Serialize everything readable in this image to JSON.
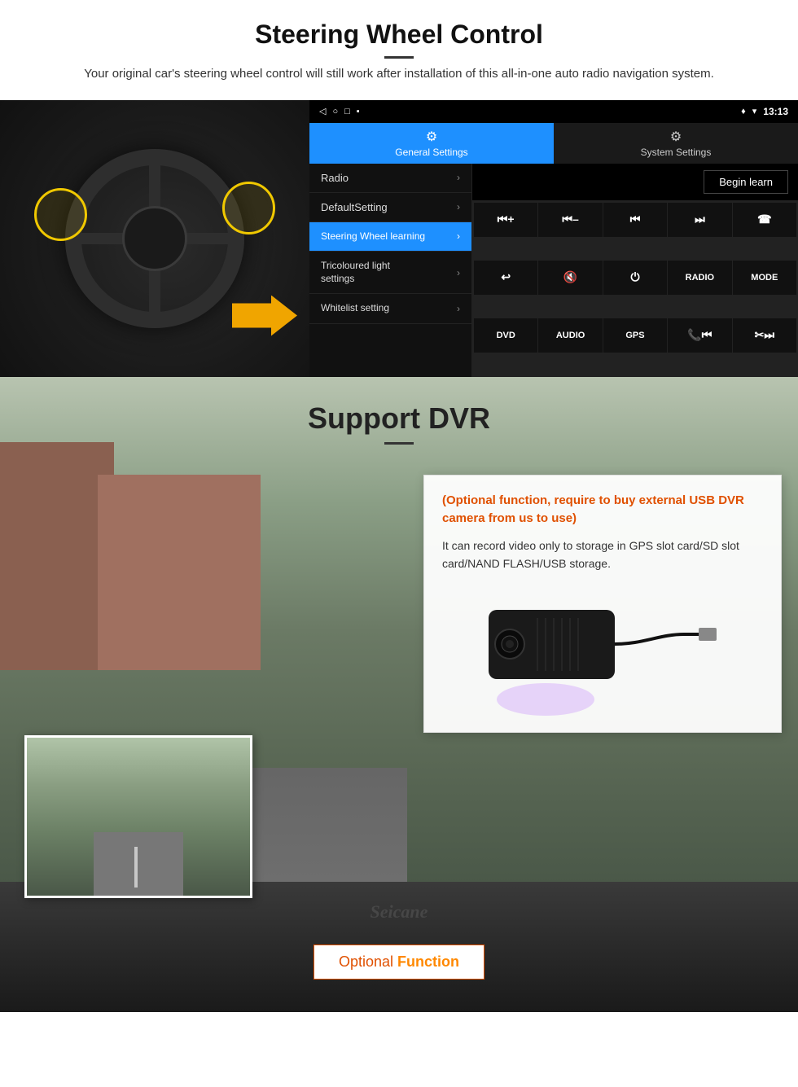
{
  "page": {
    "title": "Steering Wheel Control",
    "subtitle": "Your original car's steering wheel control will still work after installation of this all-in-one auto radio navigation system.",
    "divider": true
  },
  "android_ui": {
    "statusbar": {
      "time": "13:13",
      "signal_icon": "▼",
      "wifi_icon": "▾",
      "battery_icon": "▪"
    },
    "tabs": [
      {
        "id": "general",
        "label": "General Settings",
        "icon": "⚙",
        "active": true
      },
      {
        "id": "system",
        "label": "System Settings",
        "icon": "⚙",
        "active": false
      }
    ],
    "menu_items": [
      {
        "label": "Radio",
        "active": false
      },
      {
        "label": "DefaultSetting",
        "active": false
      },
      {
        "label": "Steering Wheel learning",
        "active": true
      },
      {
        "label": "Tricoloured light settings",
        "active": false
      },
      {
        "label": "Whitelist setting",
        "active": false
      }
    ],
    "begin_learn_button": "Begin learn",
    "control_buttons": [
      "⏮+",
      "⏮–",
      "⏮◀",
      "▶⏭",
      "☎",
      "↩",
      "🔇",
      "⏻",
      "RADIO",
      "MODE",
      "DVD",
      "AUDIO",
      "GPS",
      "📞⏮",
      "✂▶⏭"
    ]
  },
  "dvr_section": {
    "title": "Support DVR",
    "info_title": "(Optional function, require to buy external USB DVR camera from us to use)",
    "info_text": "It can record video only to storage in GPS slot card/SD slot card/NAND FLASH/USB storage."
  },
  "optional_button": {
    "label_optional": "Optional",
    "label_function": " Function"
  },
  "watermark": "Seicane"
}
